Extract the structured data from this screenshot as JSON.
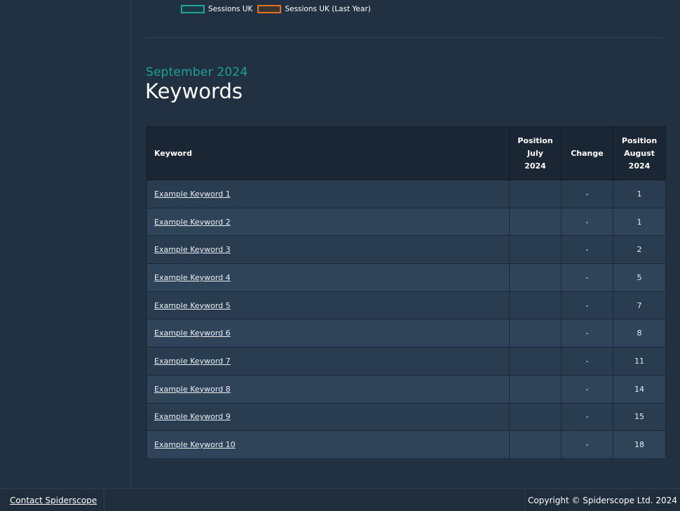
{
  "legend": {
    "items": [
      {
        "label": "Sessions UK",
        "color": "#1fa39a"
      },
      {
        "label": "Sessions UK (Last Year)",
        "color": "#e3701c"
      }
    ]
  },
  "section": {
    "subtitle": "September 2024",
    "title": "Keywords"
  },
  "table": {
    "headers": {
      "keyword": "Keyword",
      "position_july_line1": "Position",
      "position_july_line2": "July",
      "position_july_line3": "2024",
      "change": "Change",
      "position_august_line1": "Position",
      "position_august_line2": "August",
      "position_august_line3": "2024"
    },
    "rows": [
      {
        "keyword": "Example Keyword 1",
        "position_july": "",
        "change": "-",
        "position_august": "1"
      },
      {
        "keyword": "Example Keyword 2",
        "position_july": "",
        "change": "-",
        "position_august": "1"
      },
      {
        "keyword": "Example Keyword 3",
        "position_july": "",
        "change": "-",
        "position_august": "2"
      },
      {
        "keyword": "Example Keyword 4",
        "position_july": "",
        "change": "-",
        "position_august": "5"
      },
      {
        "keyword": "Example Keyword 5",
        "position_july": "",
        "change": "-",
        "position_august": "7"
      },
      {
        "keyword": "Example Keyword 6",
        "position_july": "",
        "change": "-",
        "position_august": "8"
      },
      {
        "keyword": "Example Keyword 7",
        "position_july": "",
        "change": "-",
        "position_august": "11"
      },
      {
        "keyword": "Example Keyword 8",
        "position_july": "",
        "change": "-",
        "position_august": "14"
      },
      {
        "keyword": "Example Keyword 9",
        "position_july": "",
        "change": "-",
        "position_august": "15"
      },
      {
        "keyword": "Example Keyword 10",
        "position_july": "",
        "change": "-",
        "position_august": "18"
      }
    ]
  },
  "footer": {
    "contact_label": "Contact Spiderscope",
    "copyright": "Copyright © Spiderscope Ltd. 2024"
  }
}
